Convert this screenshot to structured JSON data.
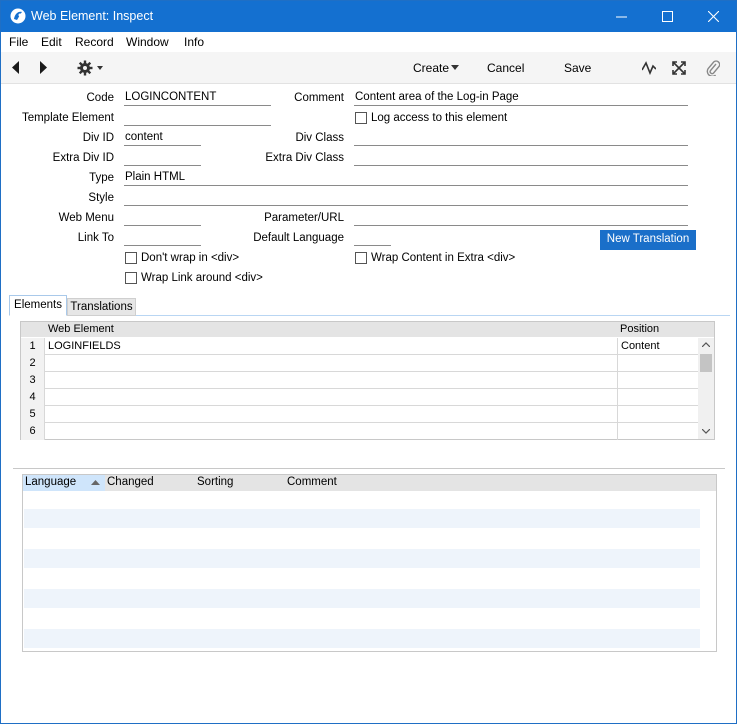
{
  "window": {
    "title": "Web Element: Inspect"
  },
  "menu": [
    "File",
    "Edit",
    "Record",
    "Window",
    "Info"
  ],
  "toolbar": {
    "create": "Create",
    "cancel": "Cancel",
    "save": "Save"
  },
  "form": {
    "code": {
      "label": "Code",
      "value": "LOGINCONTENT"
    },
    "template_element": {
      "label": "Template Element",
      "value": ""
    },
    "div_id": {
      "label": "Div ID",
      "value": "content"
    },
    "extra_div_id": {
      "label": "Extra Div ID",
      "value": ""
    },
    "type": {
      "label": "Type",
      "value": "Plain HTML"
    },
    "style": {
      "label": "Style",
      "value": ""
    },
    "web_menu": {
      "label": "Web Menu",
      "value": ""
    },
    "link_to": {
      "label": "Link To",
      "value": ""
    },
    "comment": {
      "label": "Comment",
      "value": "Content area of the Log-in Page"
    },
    "div_class": {
      "label": "Div Class",
      "value": ""
    },
    "extra_div_class": {
      "label": "Extra Div Class",
      "value": ""
    },
    "parameter_url": {
      "label": "Parameter/URL",
      "value": ""
    },
    "default_language": {
      "label": "Default Language",
      "value": ""
    },
    "log_access": {
      "label": "Log access to this element",
      "checked": false
    },
    "dont_wrap": {
      "label": "Don't wrap in <div>",
      "checked": false
    },
    "wrap_link": {
      "label": "Wrap Link around <div>",
      "checked": false
    },
    "wrap_content": {
      "label": "Wrap Content in Extra <div>",
      "checked": false
    },
    "new_translation": "New Translation"
  },
  "tabs": {
    "elements": "Elements",
    "translations": "Translations",
    "active": "Elements"
  },
  "elements_grid": {
    "headers": {
      "web_element": "Web Element",
      "position": "Position"
    },
    "rows": [
      {
        "num": "1",
        "web_element": "LOGINFIELDS",
        "position": "Content"
      },
      {
        "num": "2",
        "web_element": "",
        "position": ""
      },
      {
        "num": "3",
        "web_element": "",
        "position": ""
      },
      {
        "num": "4",
        "web_element": "",
        "position": ""
      },
      {
        "num": "5",
        "web_element": "",
        "position": ""
      },
      {
        "num": "6",
        "web_element": "",
        "position": ""
      }
    ]
  },
  "translations_list": {
    "headers": {
      "language": "Language",
      "changed": "Changed",
      "sorting": "Sorting",
      "comment": "Comment"
    },
    "sort_column": "language",
    "sort_direction": "ascending"
  },
  "colors": {
    "titlebar": "#1470d0",
    "button": "#1a6fc9",
    "accent_light": "#cfe5fb"
  }
}
